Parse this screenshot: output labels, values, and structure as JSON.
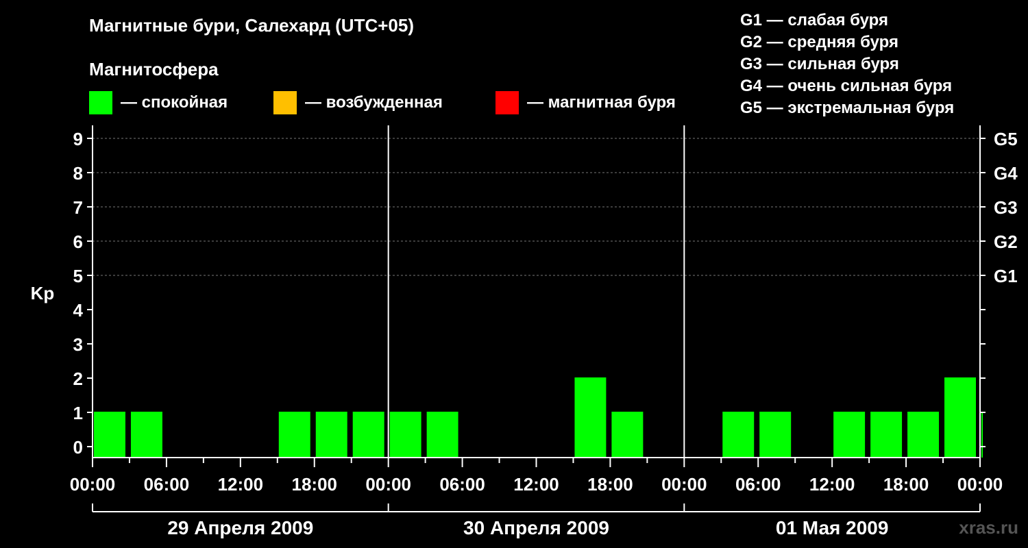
{
  "title": "Магнитные бури, Салехард (UTC+05)",
  "subtitle": "Магнитосфера",
  "legend": [
    {
      "label": "— спокойная",
      "color": "#00ff00"
    },
    {
      "label": "— возбужденная",
      "color": "#ffbf00"
    },
    {
      "label": "— магнитная буря",
      "color": "#ff0000"
    }
  ],
  "storm_scale": [
    "G1 — слабая буря",
    "G2 — средняя буря",
    "G3 — сильная буря",
    "G4 — очень сильная буря",
    "G5 — экстремальная буря"
  ],
  "watermark": "xras.ru",
  "chart_data": {
    "type": "bar",
    "ylabel": "Kp",
    "ylim": [
      0,
      9
    ],
    "y_ticks": [
      "0",
      "1",
      "2",
      "3",
      "4",
      "5",
      "6",
      "7",
      "8",
      "9"
    ],
    "right_labels": [
      {
        "y": 5,
        "label": "G1"
      },
      {
        "y": 6,
        "label": "G2"
      },
      {
        "y": 7,
        "label": "G3"
      },
      {
        "y": 8,
        "label": "G4"
      },
      {
        "y": 9,
        "label": "G5"
      }
    ],
    "x_tick_labels": [
      "00:00",
      "06:00",
      "12:00",
      "18:00",
      "00:00",
      "06:00",
      "12:00",
      "18:00",
      "00:00",
      "06:00",
      "12:00",
      "18:00",
      "00:00"
    ],
    "days": [
      "29 Апреля 2009",
      "30 Апреля 2009",
      "01 Мая 2009"
    ],
    "interval_hours": 3,
    "values": [
      1,
      1,
      0,
      0,
      0,
      1,
      1,
      1,
      1,
      1,
      0,
      0,
      0,
      2,
      1,
      0,
      0,
      1,
      1,
      0,
      1,
      1,
      1,
      2,
      1
    ],
    "bar_color": "#00ff00",
    "grid": true
  }
}
